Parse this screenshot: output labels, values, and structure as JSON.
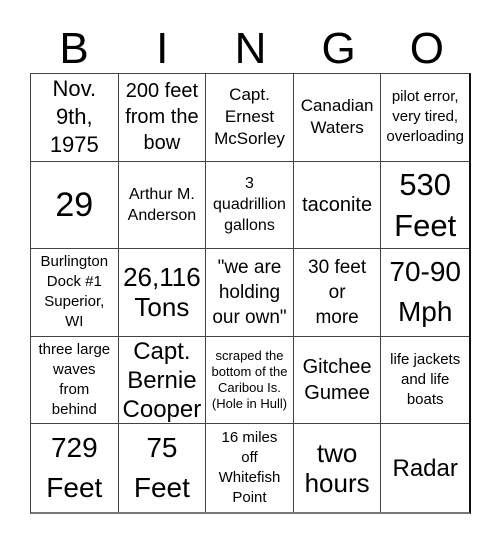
{
  "header": {
    "letters": [
      "B",
      "I",
      "N",
      "G",
      "O"
    ]
  },
  "grid": {
    "rows": [
      [
        "Nov.\n9th,\n1975",
        "200 feet\nfrom the\nbow",
        "Capt.\nErnest\nMcSorley",
        "Canadian\nWaters",
        "pilot error,\nvery tired,\noverloading"
      ],
      [
        "29",
        "Arthur M.\nAnderson",
        "3\nquadrillion\ngallons",
        "taconite",
        "530\nFeet"
      ],
      [
        "Burlington\nDock #1\nSuperior,\nWI",
        "26,116\nTons",
        "\"we are\nholding\nour own\"",
        "30 feet\nor\nmore",
        "70-90\nMph"
      ],
      [
        "three large\nwaves\nfrom\nbehind",
        "Capt.\nBernie\nCooper",
        "scraped the\nbottom of the\nCaribou Is.\n(Hole in Hull)",
        "Gitchee\nGumee",
        "life jackets\nand life\nboats"
      ],
      [
        "729\nFeet",
        "75\nFeet",
        "16 miles\noff\nWhitefish\nPoint",
        "two\nhours",
        "Radar"
      ]
    ]
  }
}
